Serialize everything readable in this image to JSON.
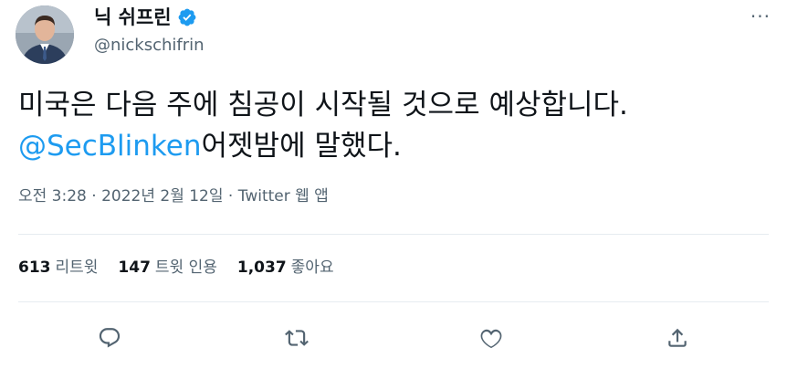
{
  "author": {
    "display_name": "닉 쉬프린",
    "handle": "@nickschifrin",
    "verified": true
  },
  "menu_label": "···",
  "tweet": {
    "text_main": "미국은 다음 주에 침공이 시작될 것으로 예상합니다.",
    "mention": "@SecBlinken",
    "text_after_mention": "어젯밤에 말했다."
  },
  "meta": {
    "time": "오전 3:28",
    "sep1": " · ",
    "date": "2022년 2월 12일",
    "sep2": " · ",
    "source": "Twitter 웹 앱"
  },
  "stats": {
    "retweets_count": "613",
    "retweets_label": "리트윗",
    "quotes_count": "147",
    "quotes_label": "트윗 인용",
    "likes_count": "1,037",
    "likes_label": "좋아요"
  },
  "colors": {
    "link": "#1d9bf0",
    "secondary_text": "#536471",
    "icon": "#536471",
    "divider": "#e6ecf0"
  },
  "icons": [
    "verified-badge-icon",
    "more-icon",
    "reply-icon",
    "retweet-icon",
    "like-icon",
    "share-icon"
  ]
}
